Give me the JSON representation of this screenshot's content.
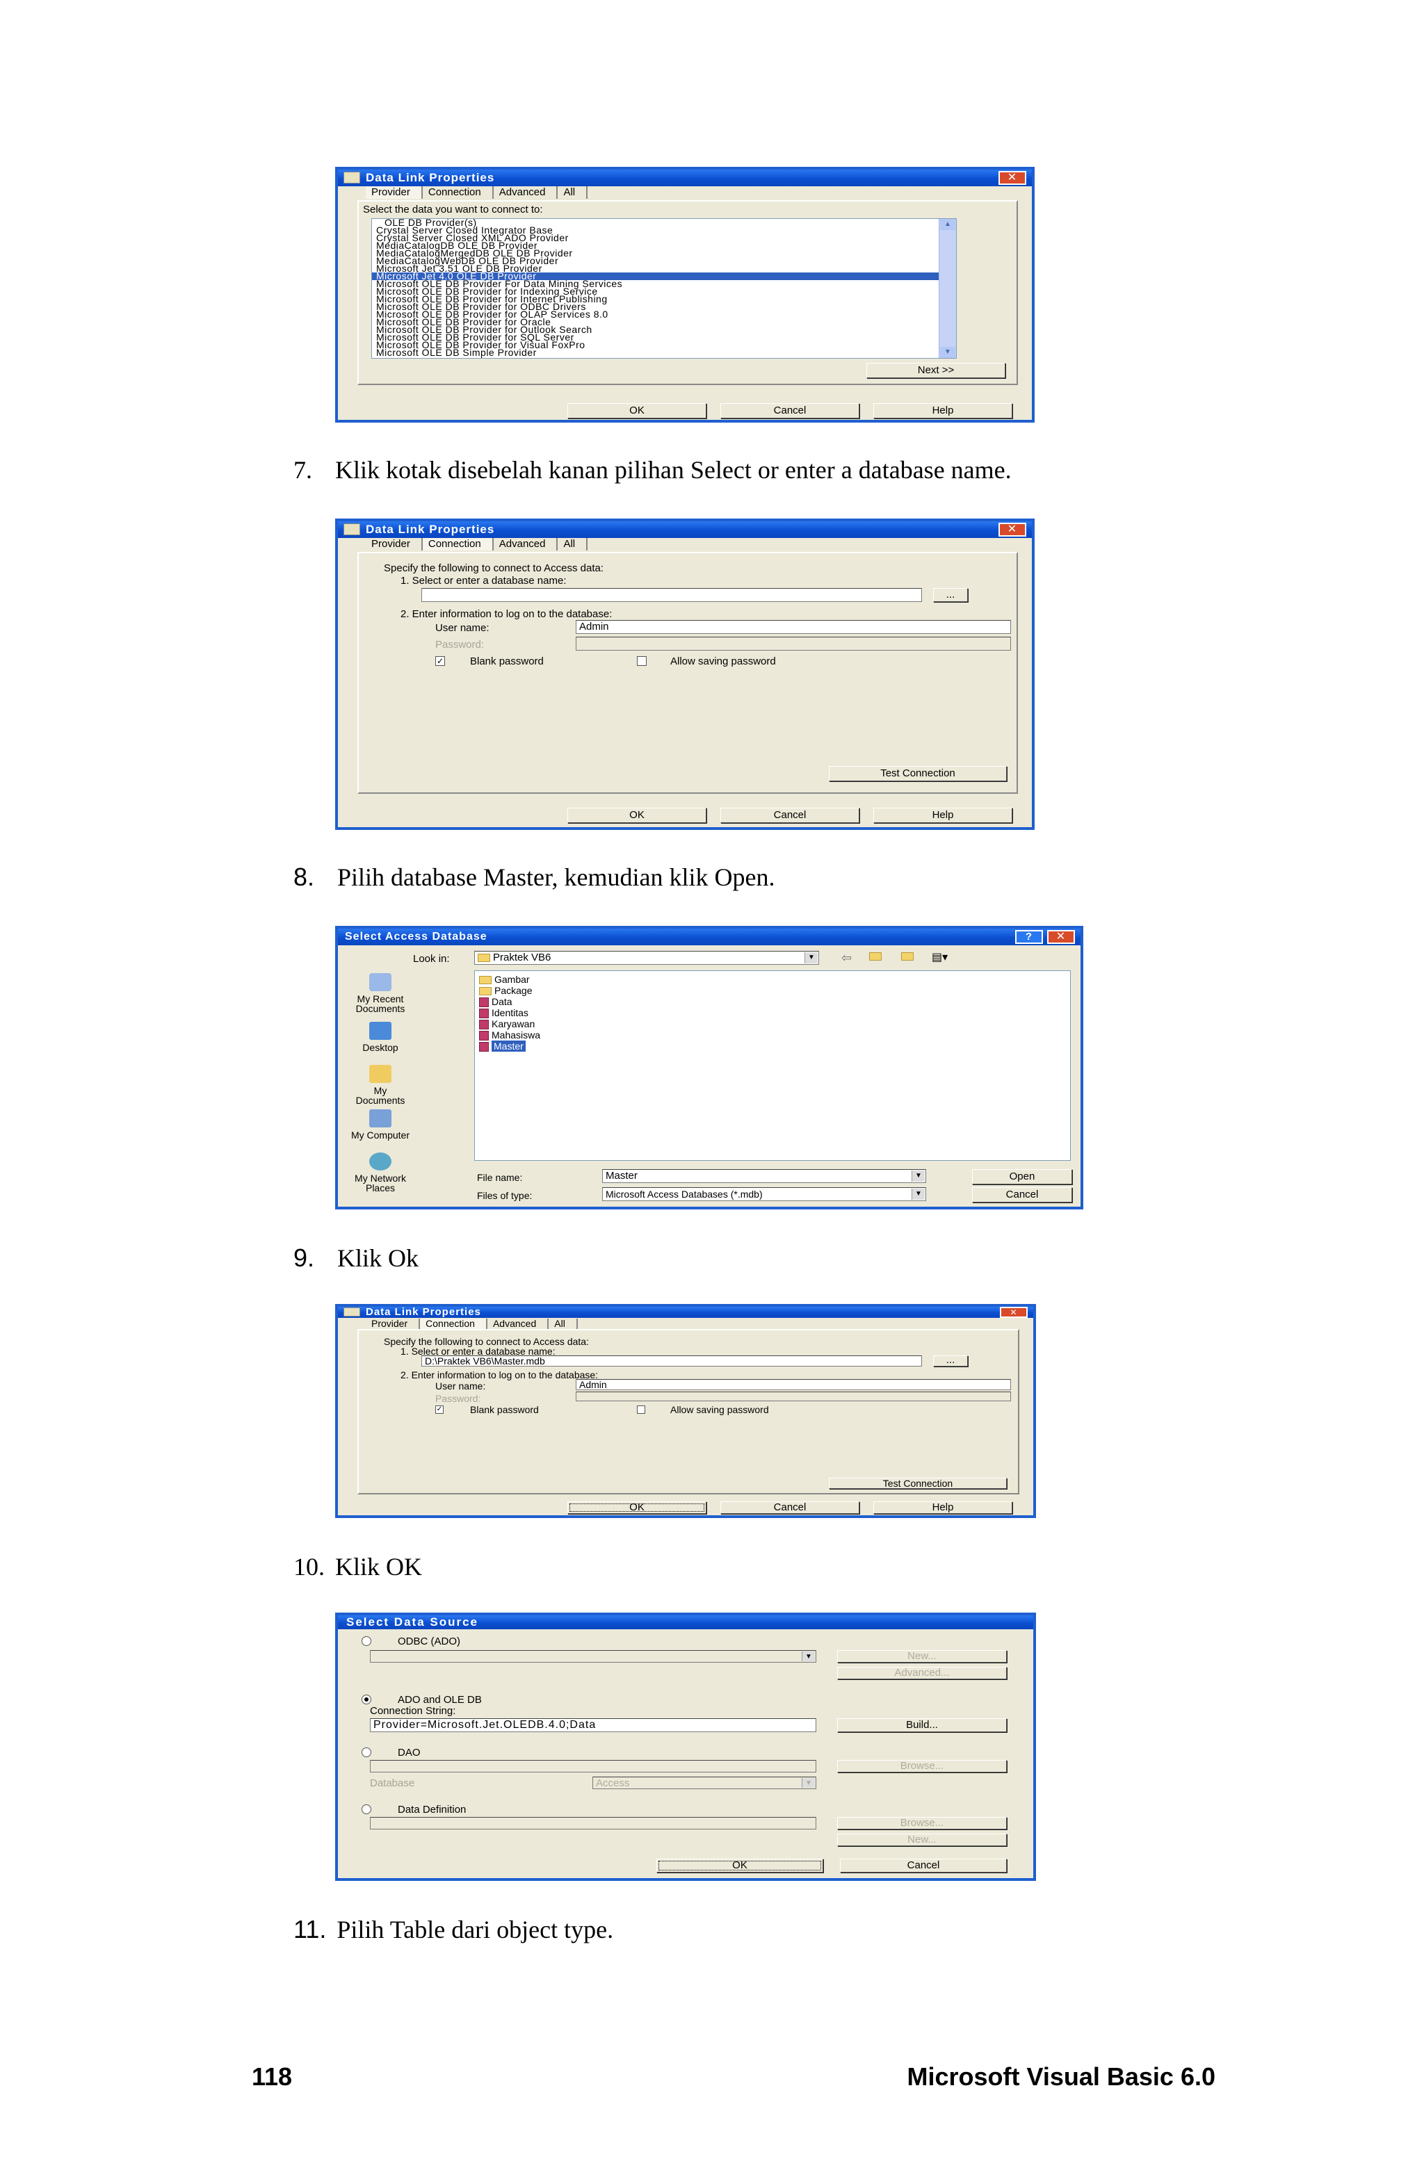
{
  "shot1": {
    "title": "Data Link Properties",
    "tabs": [
      "Provider",
      "Connection",
      "Advanced",
      "All"
    ],
    "prompt": "Select the data you want to connect to:",
    "providers": [
      "OLE DB Provider(s)",
      "Crystal Server Closed Integrator Base",
      "Crystal Server Closed XML ADO Provider",
      "MediaCatalogDB OLE DB Provider",
      "MediaCatalogMergedDB OLE DB Provider",
      "MediaCatalogWebDB OLE DB Provider",
      "Microsoft Jet 3.51 OLE DB Provider",
      "Microsoft Jet 4.0 OLE DB Provider",
      "Microsoft OLE DB Provider For Data Mining Services",
      "Microsoft OLE DB Provider for Indexing Service",
      "Microsoft OLE DB Provider for Internet Publishing",
      "Microsoft OLE DB Provider for ODBC Drivers",
      "Microsoft OLE DB Provider for OLAP Services 8.0",
      "Microsoft OLE DB Provider for Oracle",
      "Microsoft OLE DB Provider for Outlook Search",
      "Microsoft OLE DB Provider for SQL Server",
      "Microsoft OLE DB Provider for Visual FoxPro",
      "Microsoft OLE DB Simple Provider"
    ],
    "next_label": "Next >>",
    "ok_label": "OK",
    "cancel_label": "Cancel",
    "help_label": "Help"
  },
  "step7": {
    "number": "7.",
    "text": "Klik kotak disebelah kanan pilihan Select or enter a database name."
  },
  "shot2": {
    "title": "Data Link Properties",
    "tabs": [
      "Provider",
      "Connection",
      "Advanced",
      "All"
    ],
    "specify": "Specify the following to connect to Access data:",
    "select_db": "1. Select or enter a database name:",
    "db_value": "",
    "browse_label": "...",
    "enter_info": "2. Enter information to log on to the database:",
    "user_label": "User name:",
    "user_value": "Admin",
    "password_label": "Password:",
    "blank_password": "Blank password",
    "allow_saving": "Allow saving password",
    "test_label": "Test Connection",
    "ok_label": "OK",
    "cancel_label": "Cancel",
    "help_label": "Help"
  },
  "step8": {
    "number": "8.",
    "text": "Pilih database Master, kemudian klik Open."
  },
  "shot3": {
    "title": "Select Access Database",
    "help_btn": "?",
    "look_in_label": "Look in:",
    "look_in_value": "Praktek VB6",
    "places": [
      "My Recent Documents",
      "Desktop",
      "My Documents",
      "My Computer",
      "My Network Places"
    ],
    "folders": [
      "Gambar",
      "Package"
    ],
    "files": [
      "Data",
      "Identitas",
      "Karyawan",
      "Mahasiswa",
      "Master"
    ],
    "file_name_label": "File name:",
    "file_name_value": "Master",
    "file_type_label": "Files of type:",
    "file_type_value": "Microsoft Access Databases (*.mdb)",
    "open_label": "Open",
    "cancel_label": "Cancel"
  },
  "step9": {
    "number": "9.",
    "text": "Klik Ok"
  },
  "shot4": {
    "title": "Data Link Properties",
    "tabs": [
      "Provider",
      "Connection",
      "Advanced",
      "All"
    ],
    "specify": "Specify the following to connect to Access data:",
    "select_db": "1. Select or enter a database name:",
    "db_value": "D:\\Praktek VB6\\Master.mdb",
    "browse_label": "...",
    "enter_info": "2. Enter information to log on to the database:",
    "user_label": "User name:",
    "user_value": "Admin",
    "password_label": "Password:",
    "blank_password": "Blank password",
    "allow_saving": "Allow saving password",
    "test_label": "Test Connection",
    "ok_label": "OK",
    "cancel_label": "Cancel",
    "help_label": "Help"
  },
  "step10": {
    "number": "10.",
    "text": "Klik OK"
  },
  "shot5": {
    "title": "Select Data Source",
    "odbc_label": "ODBC (ADO)",
    "new_label": "New...",
    "advanced_label": "Advanced...",
    "ado_label": "ADO and OLE DB",
    "conn_string_label": "Connection String:",
    "conn_string_value": "Provider=Microsoft.Jet.OLEDB.4.0;Data",
    "build_label": "Build...",
    "dao_label": "DAO",
    "browse_label": "Browse...",
    "database_label": "Database",
    "database_value": "Access",
    "datadef_label": "Data Definition",
    "ok_label": "OK",
    "cancel_label": "Cancel"
  },
  "step11": {
    "number": "11.",
    "text": "Pilih Table dari object type."
  },
  "footer": {
    "page_number": "118",
    "book_title": "Microsoft Visual Basic 6.0"
  }
}
